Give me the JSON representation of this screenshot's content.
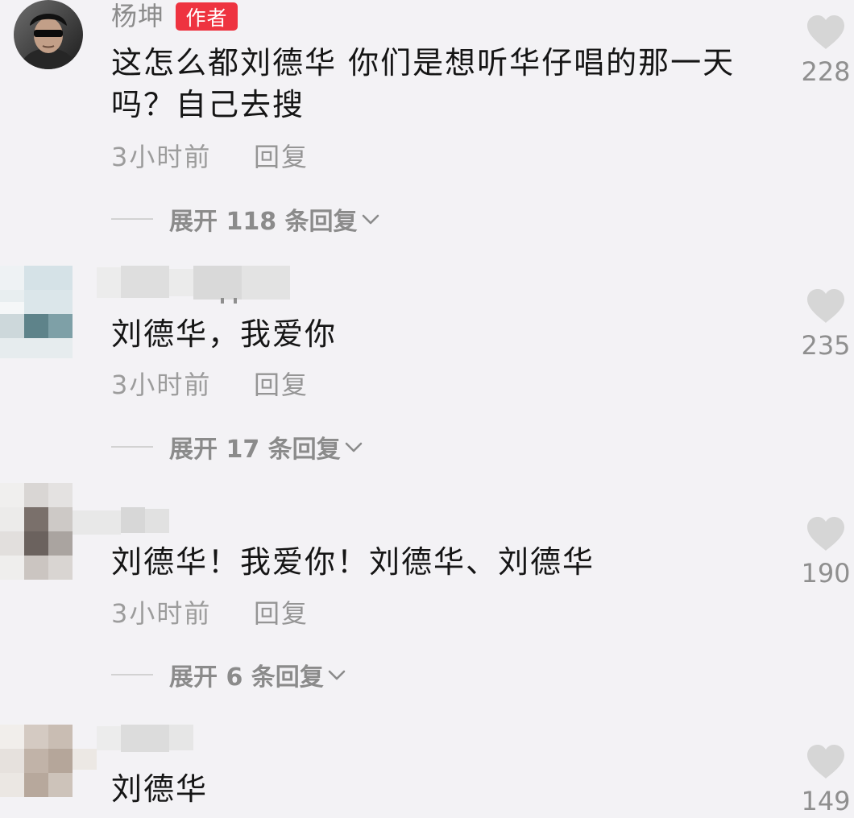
{
  "comments": [
    {
      "author": "杨坤",
      "badge": "作者",
      "text": [
        "这怎么都刘德华 你们是想听华仔唱的那一天",
        "吗？自己去搜"
      ],
      "time": "3小时前",
      "reply": "回复",
      "likes": "228",
      "expand": "展开 118 条回复"
    },
    {
      "text": [
        "刘德华，我爱你"
      ],
      "time": "3小时前",
      "reply": "回复",
      "likes": "235",
      "expand": "展开 17 条回复"
    },
    {
      "text": [
        "刘德华！我爱你！刘德华、刘德华"
      ],
      "time": "3小时前",
      "reply": "回复",
      "likes": "190",
      "expand": "展开 6 条回复"
    },
    {
      "text": [
        "刘德华"
      ],
      "likes": "149"
    }
  ],
  "icons": {
    "like": "heart-icon",
    "expand": "chevron-down-icon",
    "hidden_user": "pixelated-avatar"
  },
  "colors": {
    "background": "#f3f2f5",
    "text": "#151515",
    "secondary_text": "#9c9c9c",
    "author_badge": "#ee3340",
    "heart": "#d6d6d6"
  }
}
